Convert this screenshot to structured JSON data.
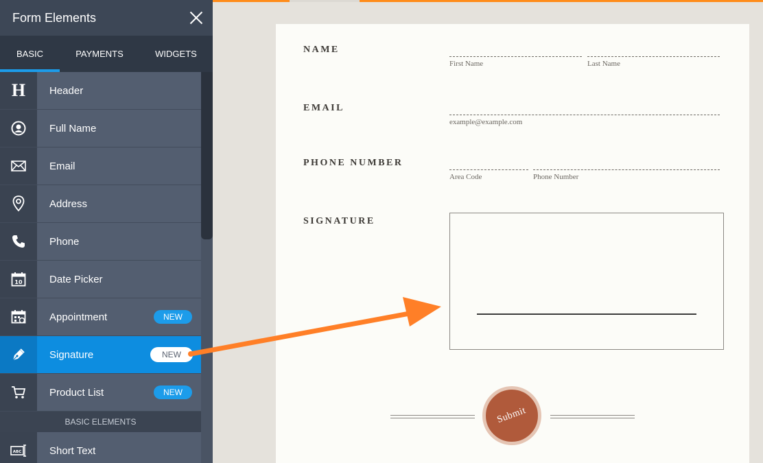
{
  "panel": {
    "title": "Form Elements",
    "tabs": [
      "BASIC",
      "PAYMENTS",
      "WIDGETS"
    ],
    "items": [
      {
        "label": "Header",
        "icon": "header-icon"
      },
      {
        "label": "Full Name",
        "icon": "user-icon"
      },
      {
        "label": "Email",
        "icon": "envelope-icon"
      },
      {
        "label": "Address",
        "icon": "map-pin-icon"
      },
      {
        "label": "Phone",
        "icon": "phone-icon"
      },
      {
        "label": "Date Picker",
        "icon": "calendar-icon",
        "icon_text": "10"
      },
      {
        "label": "Appointment",
        "icon": "appointment-icon",
        "badge": "NEW"
      },
      {
        "label": "Signature",
        "icon": "pen-icon",
        "badge": "NEW"
      },
      {
        "label": "Product List",
        "icon": "cart-icon",
        "badge": "NEW"
      }
    ],
    "section": "BASIC ELEMENTS",
    "after_section": [
      {
        "label": "Short Text",
        "icon": "short-text-icon",
        "icon_text": "ABC"
      }
    ]
  },
  "form": {
    "name": {
      "label": "NAME",
      "sub1": "First Name",
      "sub2": "Last Name"
    },
    "email": {
      "label": "EMAIL",
      "sub": "example@example.com"
    },
    "phone": {
      "label": "PHONE NUMBER",
      "sub1": "Area Code",
      "sub2": "Phone Number"
    },
    "signature": {
      "label": "SIGNATURE"
    },
    "submit": "Submit"
  },
  "colors": {
    "accent": "#ff8c1a",
    "active_item": "#0d8de0",
    "badge": "#1c9cea",
    "submit": "#b05a3b"
  }
}
